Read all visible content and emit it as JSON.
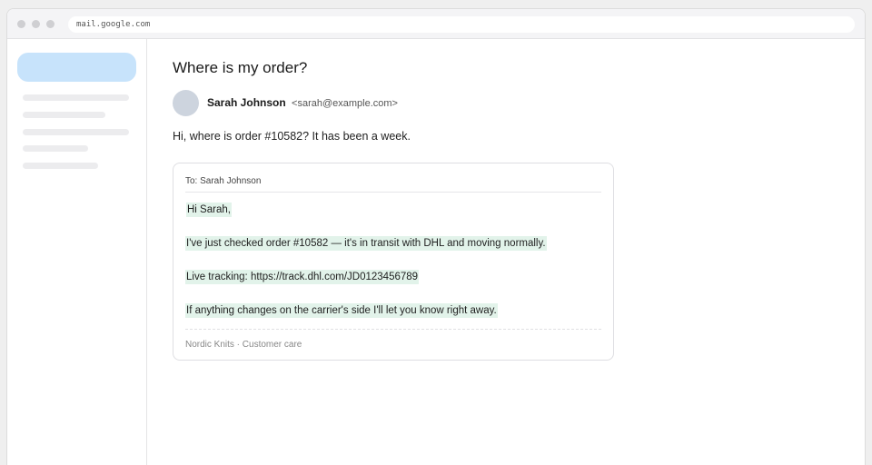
{
  "browser": {
    "url": "mail.google.com"
  },
  "email": {
    "subject": "Where is my order?",
    "sender_name": "Sarah Johnson",
    "sender_email": "<sarah@example.com>",
    "body": "Hi, where is order #10582? It has been a week."
  },
  "reply": {
    "to": "To: Sarah Johnson",
    "lines": [
      "Hi Sarah,",
      "I've just checked order #10582 — it's in transit with DHL and moving normally.",
      "Live tracking: https://track.dhl.com/JD0123456789",
      "If anything changes on the carrier's side I'll let you know right away."
    ],
    "signature": "Nordic Knits · Customer care"
  }
}
